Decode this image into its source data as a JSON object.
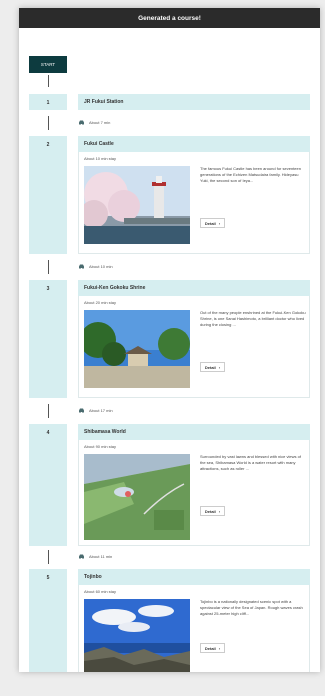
{
  "header": {
    "title": "Generated a course!"
  },
  "start_label": "START",
  "stops": [
    {
      "number": "1",
      "name": "JR Fukui Station"
    },
    {
      "number": "2",
      "name": "Fukui Castle",
      "stay": "About 10 min stay",
      "desc": "The famous Fukui Castle has been around for seventeen generations of the Echizen Matsudaira family. Hideyasu Yuki, the second son of Ieya...",
      "detail": "Detail"
    },
    {
      "number": "3",
      "name": "Fukui-Ken Gokoku Shrine",
      "stay": "About 20 min stay",
      "desc": "Out of the many people enshrined at the Fukui-Ken Gokoku Shrine, is one Sanai Hashimoto, a brilliant doctor who lived during the closing ...",
      "detail": "Detail"
    },
    {
      "number": "4",
      "name": "Shibamasa World",
      "stay": "About 90 min stay",
      "desc": "Surrounded by vast lawns and blessed with nice views of the sea, Shibamasa World is a water resort with many attractions, such as roller ...",
      "detail": "Detail"
    },
    {
      "number": "5",
      "name": "Tojinbo",
      "stay": "About 60 min stay",
      "desc": "Tojinbo is a nationally designated scenic spot with a spectacular view of the Sea of Japan. Rough waves crash against 25-meter high cliff...",
      "detail": "Detail"
    }
  ],
  "transits": [
    {
      "icon": "car-icon",
      "label": "About 7 min"
    },
    {
      "icon": "car-icon",
      "label": "About 10 min"
    },
    {
      "icon": "car-icon",
      "label": "About 17 min"
    },
    {
      "icon": "car-icon",
      "label": "About 11 min"
    }
  ]
}
